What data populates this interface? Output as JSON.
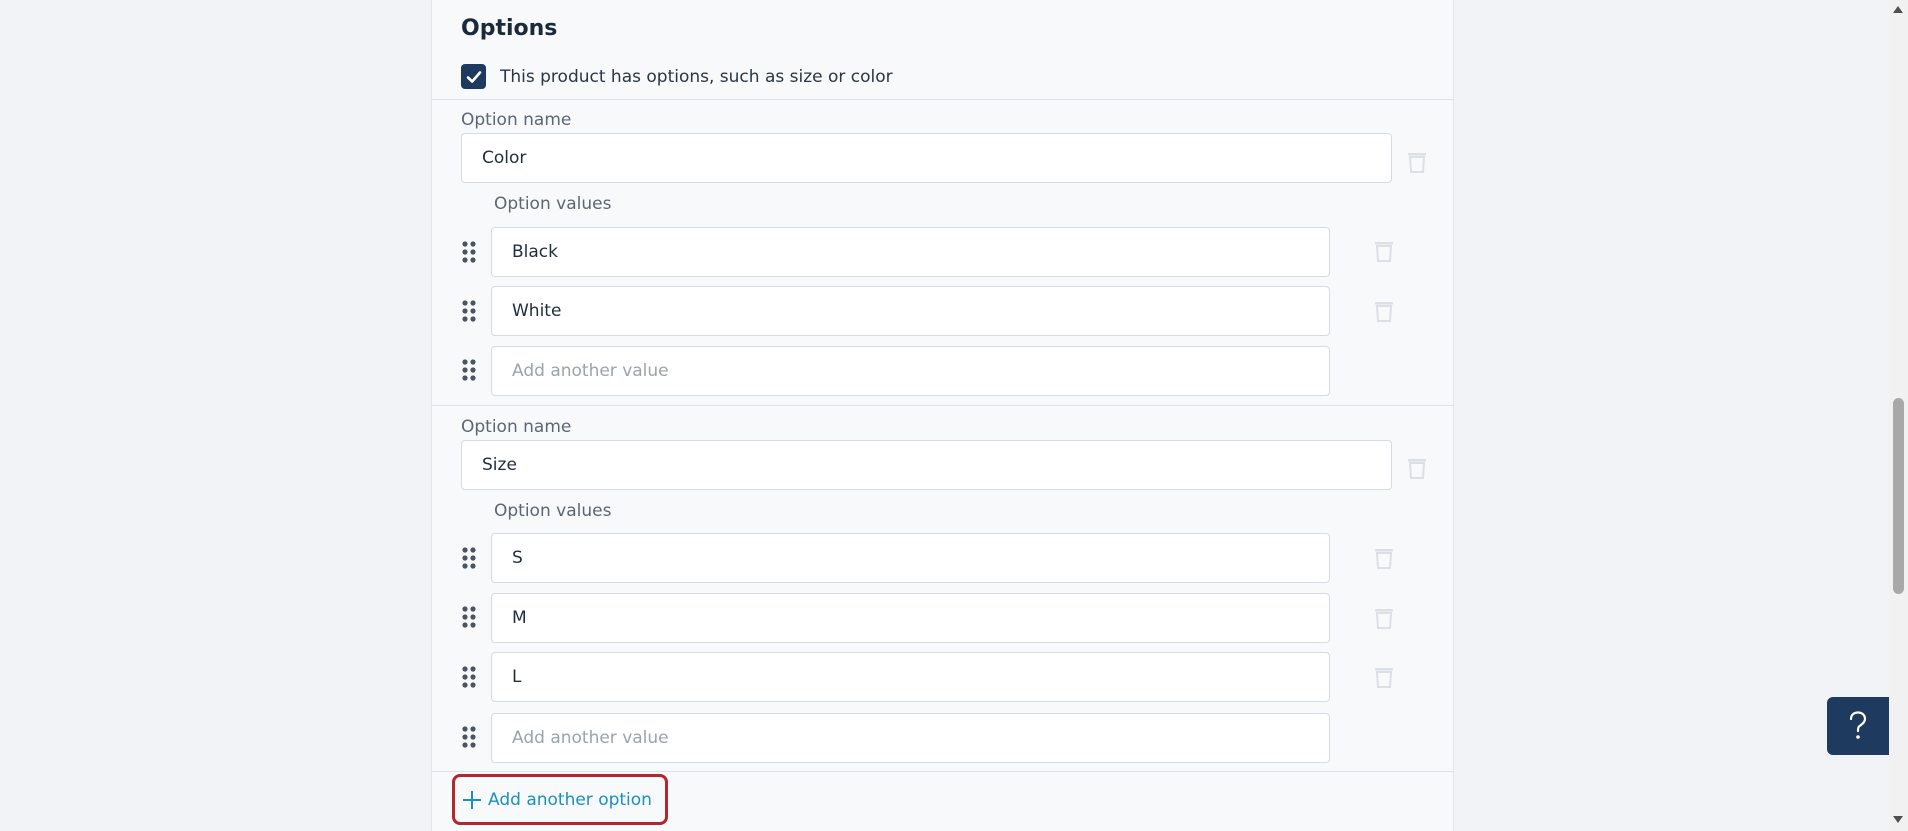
{
  "section": {
    "title": "Options",
    "has_options_label": "This product has options, such as size or color",
    "has_options_checked": true
  },
  "options": [
    {
      "name_label": "Option name",
      "name_value": "Color",
      "values_label": "Option values",
      "values": [
        "Black",
        "White"
      ],
      "add_value_placeholder": "Add another value"
    },
    {
      "name_label": "Option name",
      "name_value": "Size",
      "values_label": "Option values",
      "values": [
        "S",
        "M",
        "L"
      ],
      "add_value_placeholder": "Add another value"
    }
  ],
  "add_option_label": "Add another option",
  "help": {
    "icon": "question-icon",
    "glyph": "?"
  },
  "colors": {
    "accent": "#1a8fc2",
    "navy": "#1e3a5f",
    "highlight": "#b3262d"
  }
}
